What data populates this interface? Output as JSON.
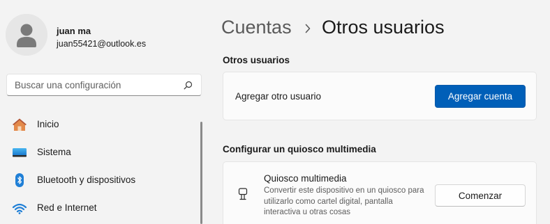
{
  "user": {
    "name": "juan ma",
    "email": "juan55421@outlook.es"
  },
  "search": {
    "placeholder": "Buscar una configuración",
    "icon": "search-icon"
  },
  "sidebar": {
    "items": [
      {
        "label": "Inicio",
        "icon": "home-icon"
      },
      {
        "label": "Sistema",
        "icon": "monitor-icon"
      },
      {
        "label": "Bluetooth y dispositivos",
        "icon": "bluetooth-icon"
      },
      {
        "label": "Red e Internet",
        "icon": "wifi-icon"
      }
    ]
  },
  "breadcrumb": {
    "parent": "Cuentas",
    "current": "Otros usuarios"
  },
  "sections": {
    "other_users": {
      "title": "Otros usuarios",
      "row_label": "Agregar otro usuario",
      "button_label": "Agregar cuenta"
    },
    "kiosk": {
      "title": "Configurar un quiosco multimedia",
      "row_title": "Quiosco multimedia",
      "row_description": "Convertir este dispositivo en un quiosco para utilizarlo como cartel digital, pantalla interactiva u otras cosas",
      "button_label": "Comenzar",
      "icon": "kiosk-icon"
    }
  },
  "colors": {
    "accent": "#005fb8",
    "background": "#f3f3f3",
    "card": "#fbfbfb"
  }
}
